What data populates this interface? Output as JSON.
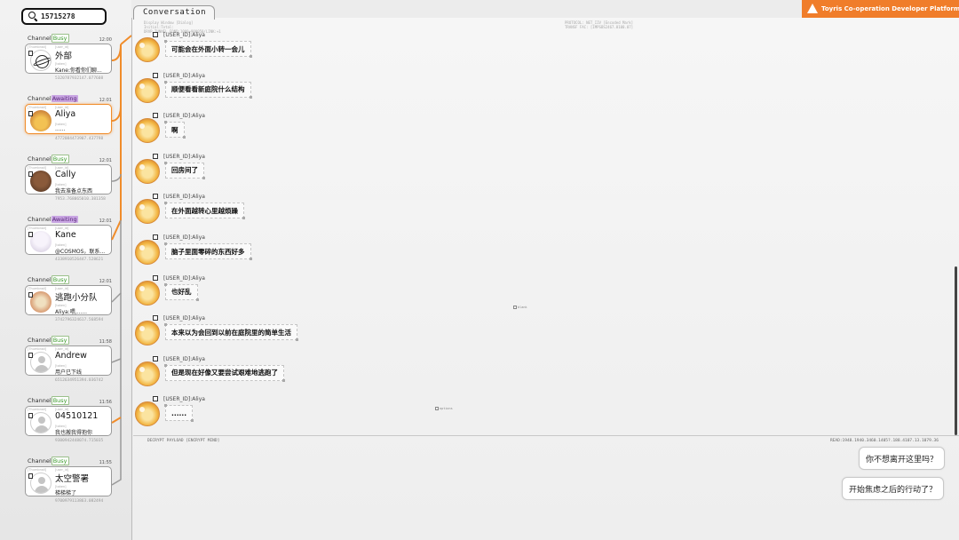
{
  "app": {
    "brand": "Toyris Co-operation Developer Platform"
  },
  "search": {
    "value": "15715278"
  },
  "channels": [
    {
      "label": "Channel",
      "status": "Busy",
      "time": "12:00",
      "name": "外部",
      "preview": "Kane:你看你们聊...",
      "id": "5320787932147.077608",
      "thumb": "[Thumbnail]",
      "uid": "[user_id]",
      "tok": "[token]"
    },
    {
      "label": "Channel",
      "status": "Awaiting",
      "time": "12:01",
      "name": "Aliya",
      "preview": "......",
      "id": "4772084473907.437798",
      "thumb": "[Thumbnail]",
      "uid": "[user_id]",
      "tok": "[token]"
    },
    {
      "label": "Channel",
      "status": "Busy",
      "time": "12:01",
      "name": "Cally",
      "preview": "我去准备点东西",
      "id": "7953.768065010.381358",
      "thumb": "[Thumbnail]",
      "uid": "[user_id]",
      "tok": "[token]"
    },
    {
      "label": "Channel",
      "status": "Awaiting",
      "time": "12:01",
      "name": "Kane",
      "preview": "@COSMOS，联系...",
      "id": "4338910526447.528621",
      "thumb": "[Thumbnail]",
      "uid": "[user_id]",
      "tok": "[token]"
    },
    {
      "label": "Channel",
      "status": "Busy",
      "time": "12:01",
      "name": "逃跑小分队",
      "preview": "Aliya:喂,......",
      "id": "3742796324617.568594",
      "thumb": "[Thumbnail]",
      "uid": "[user_id]",
      "tok": "[token]"
    },
    {
      "label": "Channel",
      "status": "Busy",
      "time": "11:58",
      "name": "Andrew",
      "preview": "用户已下线",
      "id": "6512634951394.036742",
      "thumb": "[Thumbnail]",
      "uid": "[user_id]",
      "tok": "[token]"
    },
    {
      "label": "Channel",
      "status": "Busy",
      "time": "11:56",
      "name": "04510121",
      "preview": "我也搬我得抱你",
      "id": "9300942448074.715035",
      "thumb": "[Thumbnail]",
      "uid": "[user_id]",
      "tok": "[token]"
    },
    {
      "label": "Channel",
      "status": "Busy",
      "time": "11:55",
      "name": "太空警署",
      "preview": "梯梯梯了",
      "id": "9700979113863.082494",
      "thumb": "[Thumbnail]",
      "uid": "[user_id]",
      "tok": "[token]"
    }
  ],
  "conversation": {
    "tab": "Conversation",
    "hdr_l1": "Display Window [Dialog]",
    "hdr_l2": "Initial:Total:",
    "hdr_l3": "DRVR_TUNNEL FOND:1000+900050/LINK:+1",
    "hdr_r1": "PROTOCOL: NET_IIV [Encoded Mark]",
    "hdr_r2": "TRANSF FAC: [IMPSBS2467.0100.07]",
    "messages": [
      {
        "user": "[USER_ID]:Aliya",
        "text": "可能会在外面小转一会儿"
      },
      {
        "user": "[USER_ID]:Aliya",
        "text": "顺便看看新庭院什么结构"
      },
      {
        "user": "[USER_ID]:Aliya",
        "text": "啊"
      },
      {
        "user": "[USER_ID]:Aliya",
        "text": "回房间了"
      },
      {
        "user": "[USER_ID]:Aliya",
        "text": "在外面越转心里越烦躁"
      },
      {
        "user": "[USER_ID]:Aliya",
        "text": "脑子里面零碎的东西好多"
      },
      {
        "user": "[USER_ID]:Aliya",
        "text": "也好乱"
      },
      {
        "user": "[USER_ID]:Aliya",
        "text": "本来以为会回到以前在庭院里的简单生活"
      },
      {
        "user": "[USER_ID]:Aliya",
        "text": "但是现在好像又要尝试艰难地逃跑了"
      },
      {
        "user": "[USER_ID]:Aliya",
        "text": "......"
      }
    ],
    "marker_blank": "blank",
    "marker_options": "options"
  },
  "footer": {
    "decrypt": "DECRYPT PAYLOAD [ENCRYPT MIND]",
    "read": "READ:1948.1940.3460.1405?.188.4107.13.1079.36"
  },
  "replies": [
    "你不想离开这里吗？",
    "开始焦虑之后的行动了？"
  ],
  "colors": {
    "accent": "#f07d2a",
    "busy": "#3a9a2a",
    "awaiting": "#c9a6e3"
  }
}
